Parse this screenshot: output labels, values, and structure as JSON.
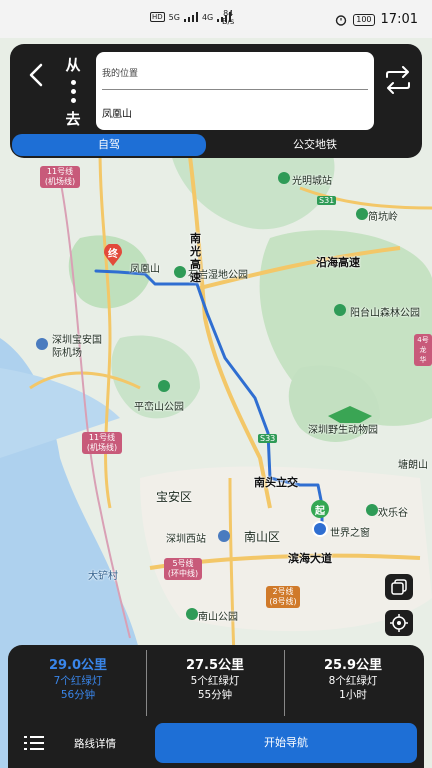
{
  "status_bar": {
    "hd_label": "HD",
    "signal_5g": "5G",
    "signal_4g": "4G",
    "net_speed_value": "84",
    "net_speed_unit": "B/s",
    "battery": "100",
    "time": "17:01"
  },
  "header": {
    "from_char": "从",
    "to_char": "去",
    "origin": "我的位置",
    "destination": "凤凰山"
  },
  "modes": {
    "drive": "自驾",
    "transit": "公交地铁",
    "active": "drive"
  },
  "map_labels": {
    "guangming": "光明城站",
    "s31": "S31",
    "jiankengling": "简坑岭",
    "fenghuangshan": "凤凰山",
    "shiyan": "石岩湿地公园",
    "nanguang": "南光高速",
    "yanhai": "沿海高速",
    "yangtaishan": "阳台山森林公园",
    "airport": "深圳宝安国际机场",
    "pingluan": "平峦山公园",
    "zoo": "深圳野生动物园",
    "s33": "S33",
    "tangxiong": "塘朗山",
    "nantou": "南头立交",
    "baoan": "宝安区",
    "huanle": "欢乐谷",
    "shenzhen_west": "深圳西站",
    "nanshan": "南山区",
    "window": "世界之窗",
    "binhai": "滨海大道",
    "dachan": "大铲村",
    "nanshan_park": "南山公园",
    "end_marker": "终",
    "start_marker": "起"
  },
  "metro_labels": {
    "line11_top": "11号线(机场线)",
    "line11_bottom": "11号线(机场线)",
    "line5": "5号线(环中线)",
    "line2": "2号线(8号线)",
    "line4": "4号龙华"
  },
  "routes": [
    {
      "distance": "29.0公里",
      "lights": "7个红绿灯",
      "time": "56分钟",
      "selected": true
    },
    {
      "distance": "27.5公里",
      "lights": "5个红绿灯",
      "time": "55分钟",
      "selected": false
    },
    {
      "distance": "25.9公里",
      "lights": "8个红绿灯",
      "time": "1小时",
      "selected": false
    }
  ],
  "actions": {
    "details": "路线详情",
    "start_nav": "开始导航"
  },
  "colors": {
    "accent": "#1e6fd6",
    "selected_route": "#3a86ea",
    "panel": "#1e1e1e"
  }
}
